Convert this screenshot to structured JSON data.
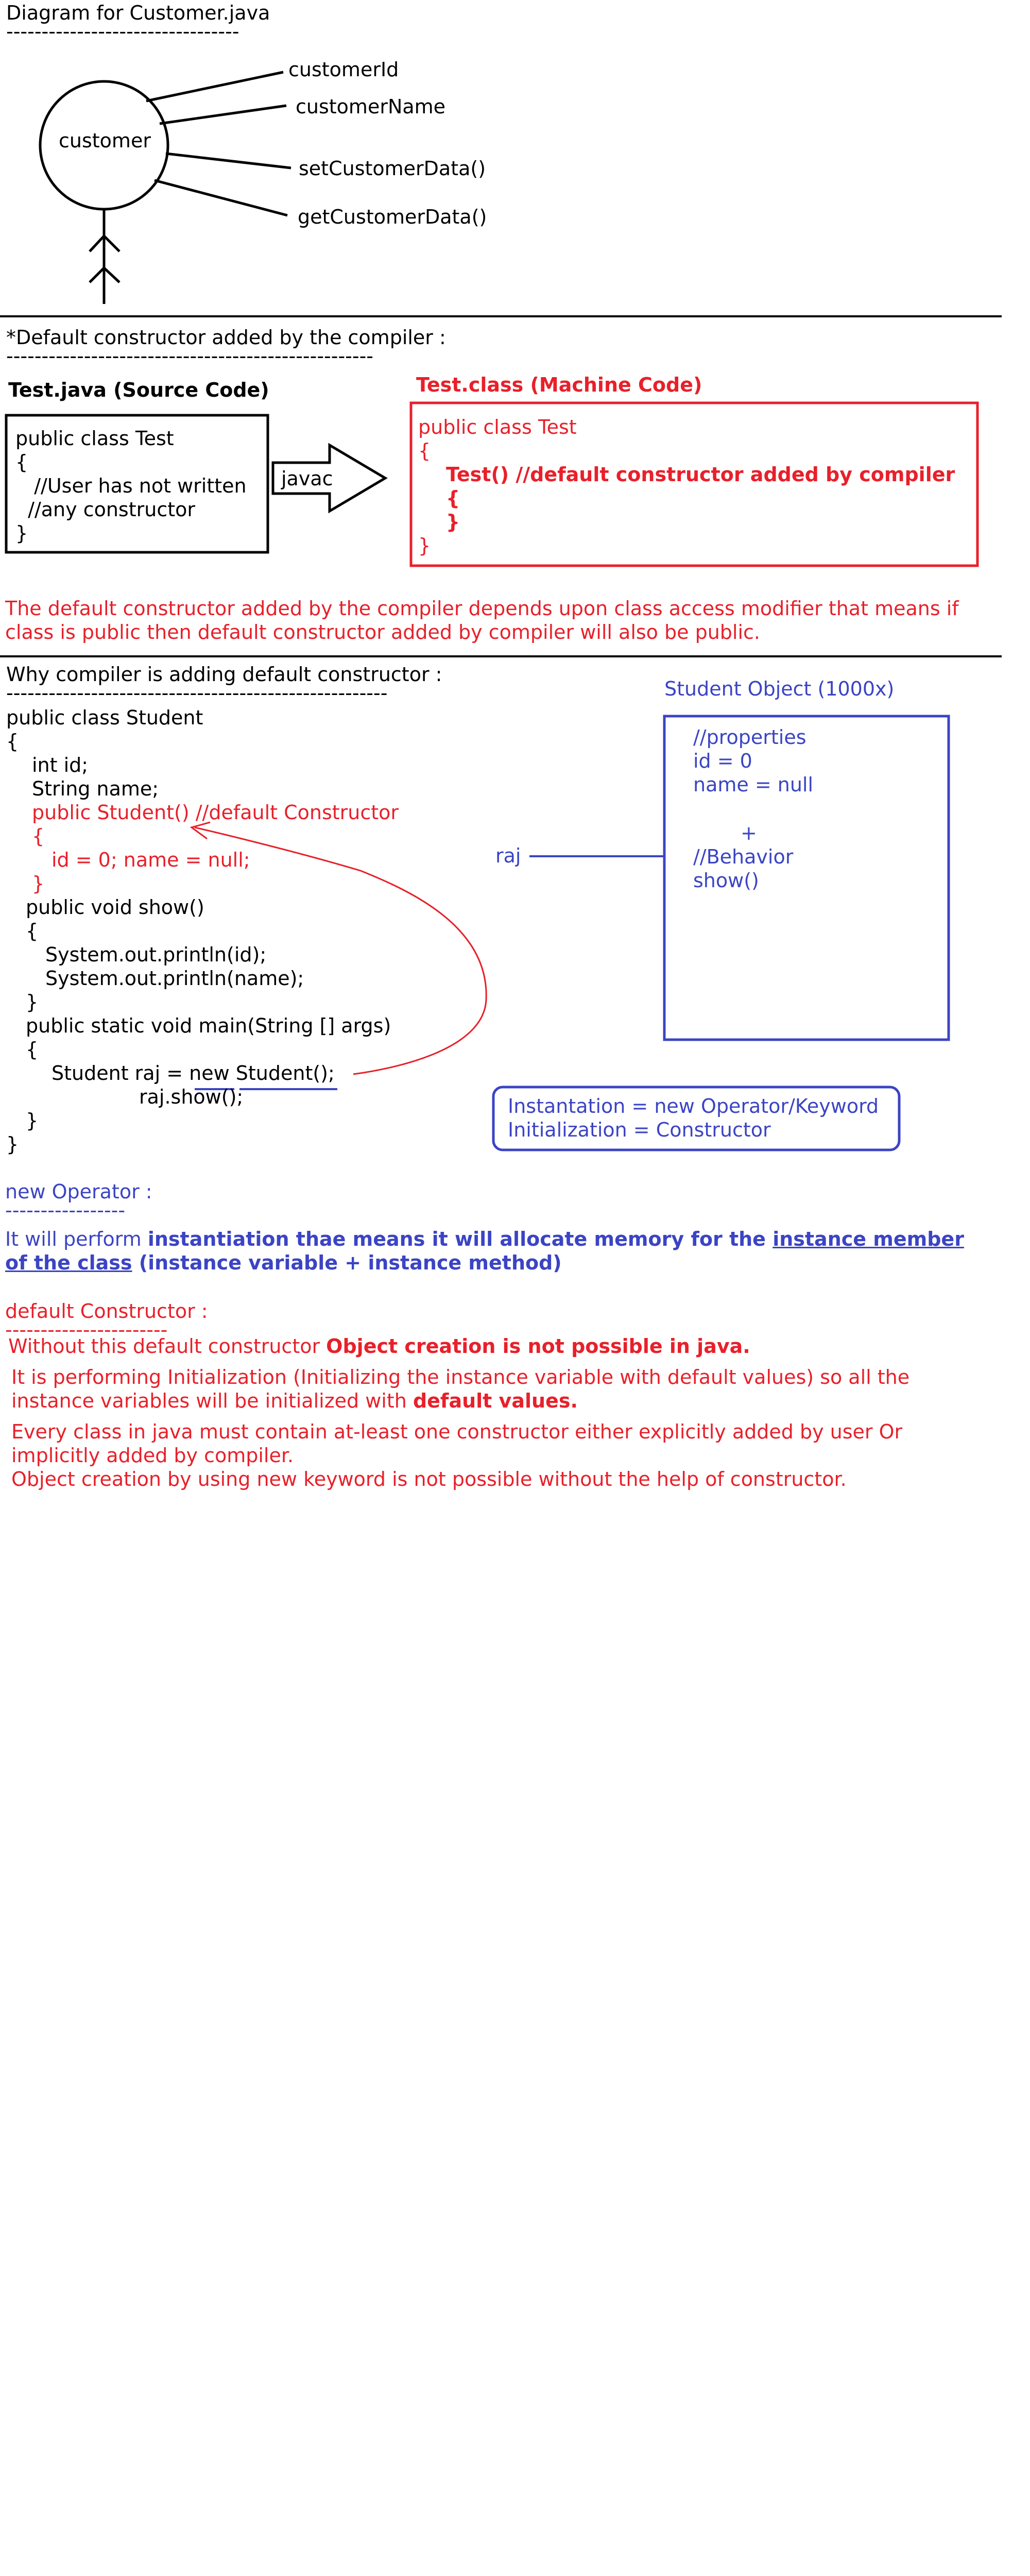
{
  "section1": {
    "title": "Diagram for Customer.java",
    "underline": "---------------------------------",
    "actor_label": "customer",
    "members": [
      "customerId",
      "customerName",
      "setCustomerData()",
      "getCustomerData()"
    ]
  },
  "section2": {
    "title": "*Default constructor added by the compiler :",
    "underline": "----------------------------------------------------",
    "source_heading": "Test.java (Source Code)",
    "source_lines": [
      "public class Test",
      "{",
      "   //User has not written",
      "  //any constructor",
      "}"
    ],
    "arrow_label": "javac",
    "machine_heading": "Test.class (Machine Code)",
    "machine_lines": [
      "public class Test",
      "{",
      "Test() //default constructor added by compiler",
      "{",
      "}",
      "}"
    ],
    "note": "The default constructor added by the compiler depends upon class access modifier that means if class is public then default constructor added by compiler will also be public."
  },
  "section3": {
    "title": "Why compiler is adding default constructor :",
    "underline": "------------------------------------------------------",
    "code": [
      "public class Student",
      "{",
      "int id;",
      "String name;",
      "public Student() //default Constructor",
      "{",
      "id = 0; name = null;",
      "}",
      "public void show()",
      "{",
      "System.out.println(id);",
      "System.out.println(name);",
      "}",
      "public static void main(String [] args)",
      "{",
      "Student raj = new Student();",
      "raj.show();",
      "}",
      "}"
    ],
    "object_heading": "Student Object (1000x)",
    "object_lines": [
      "//properties",
      "id = 0",
      "name = null",
      "+",
      "//Behavior",
      "show()"
    ],
    "ref_label": "raj",
    "note_box": [
      "Instantation = new Operator/Keyword",
      "Initialization = Constructor"
    ]
  },
  "section4": {
    "new_title": "new Operator :",
    "new_underline": "-----------------",
    "new_text_1": "It will perform ",
    "new_text_bold": "instantiation thae means it will allocate memory for the ",
    "new_text_link": "instance member of the class",
    "new_text_end": " (instance variable + instance method)",
    "dc_title": "default Constructor :",
    "dc_underline": "-----------------------",
    "dc_line1_normal": "Without this default constructor ",
    "dc_line1_bold": "Object creation is not possible in java.",
    "dc_para2_normal": "It is performing Initialization (Initializing the instance variable with default values) so all the instance variables will be initialized with ",
    "dc_para2_bold": "default values.",
    "dc_para3": "Every class in java must contain at-least one constructor either explicitly added by user Or implicitly added by compiler.",
    "dc_para4": "Object creation by using new keyword is not possible without the help of constructor."
  },
  "colors": {
    "red": "#e8202a",
    "blue": "#3b44c4",
    "black": "#000000"
  }
}
